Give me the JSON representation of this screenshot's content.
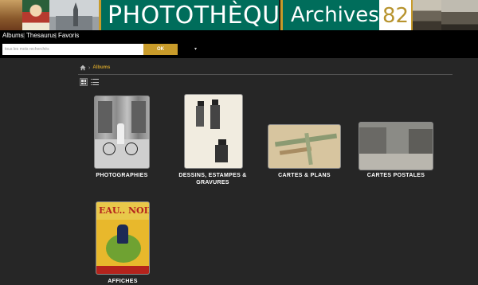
{
  "banner": {
    "title": "PHOTOTHÈQUE",
    "archives_label": "Archives",
    "archives_number": "82"
  },
  "nav": {
    "albums": "Albums",
    "thesaurus": "Thesaurus",
    "favoris": "Favoris"
  },
  "search": {
    "placeholder": "tous les mots recherchés",
    "button_label": "OK",
    "dropdown_icon": "▾"
  },
  "breadcrumb": {
    "home_icon": "home-icon",
    "separator": "›",
    "current": "Albums"
  },
  "view_toggles": [
    "grid-view-icon",
    "list-view-icon"
  ],
  "albums": [
    {
      "label": "PHOTOGRAPHIES"
    },
    {
      "label": "DESSINS, ESTAMPES & GRAVURES"
    },
    {
      "label": "CARTES & PLANS"
    },
    {
      "label": "CARTES POSTALES"
    },
    {
      "label": "AFFICHES"
    }
  ],
  "poster_text": "EAU.. NOIX SERRES",
  "colors": {
    "banner_green": "#006d5b",
    "accent_gold": "#c89b2a",
    "background": "#262626"
  }
}
